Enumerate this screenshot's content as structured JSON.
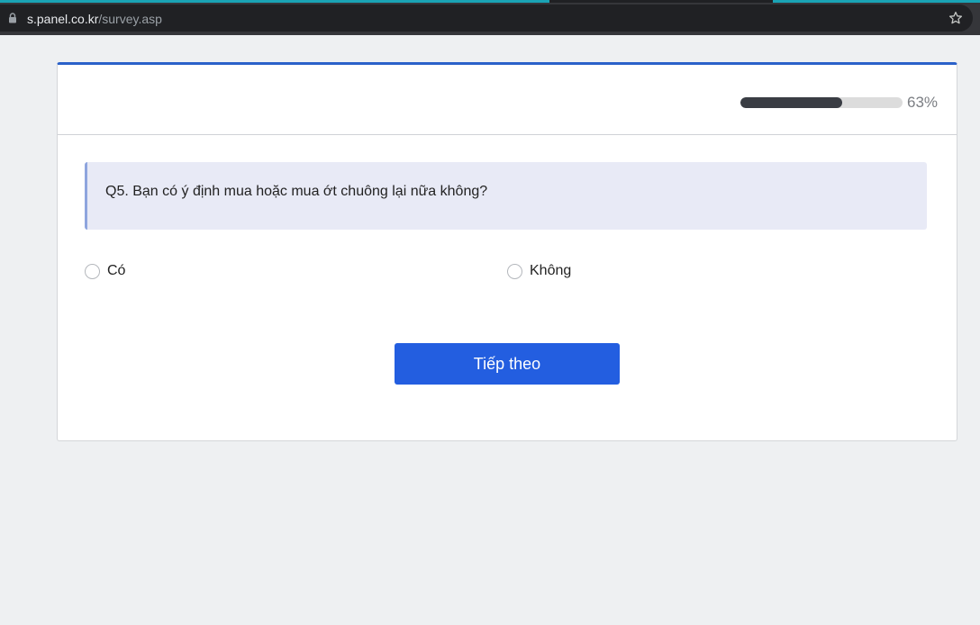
{
  "browser": {
    "url_host": "s.panel.co.kr",
    "url_path": "/survey.asp",
    "icons": {
      "lock": "lock-icon",
      "bookmark": "star-icon"
    }
  },
  "survey": {
    "progress": {
      "percent": 63,
      "label": "63%"
    },
    "question": "Q5. Bạn có ý định mua hoặc mua ớt chuông lại nữa không?",
    "options": [
      {
        "label": "Có",
        "selected": false
      },
      {
        "label": "Không",
        "selected": false
      }
    ],
    "next_label": "Tiếp theo"
  },
  "colors": {
    "accent": "#2b61c9",
    "button": "#235ee0",
    "progress_fill": "#3a3d44",
    "progress_track": "#dcdcdc",
    "question_bg": "#e8eaf6"
  }
}
